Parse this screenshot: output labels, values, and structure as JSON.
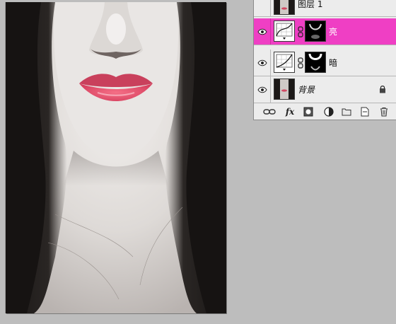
{
  "document": {
    "image_description_icon": "photo-canvas"
  },
  "layers_panel": {
    "layers": [
      {
        "name": "图层 1",
        "visible": false,
        "selected": false,
        "type": "pixel"
      },
      {
        "name": "亮",
        "visible": true,
        "selected": true,
        "type": "curves-adjustment"
      },
      {
        "name": "暗",
        "visible": true,
        "selected": false,
        "type": "curves-adjustment"
      },
      {
        "name": "背景",
        "visible": true,
        "selected": false,
        "type": "background",
        "locked": true
      }
    ],
    "footer_icons": [
      "link-layers-icon",
      "fx-icon",
      "add-mask-icon",
      "adjustment-layer-icon",
      "new-group-icon",
      "new-layer-icon",
      "trash-icon"
    ],
    "fx_label": "fx"
  },
  "colors": {
    "selected_row": "#ef3fc4",
    "workspace_bg": "#bdbdbd"
  }
}
